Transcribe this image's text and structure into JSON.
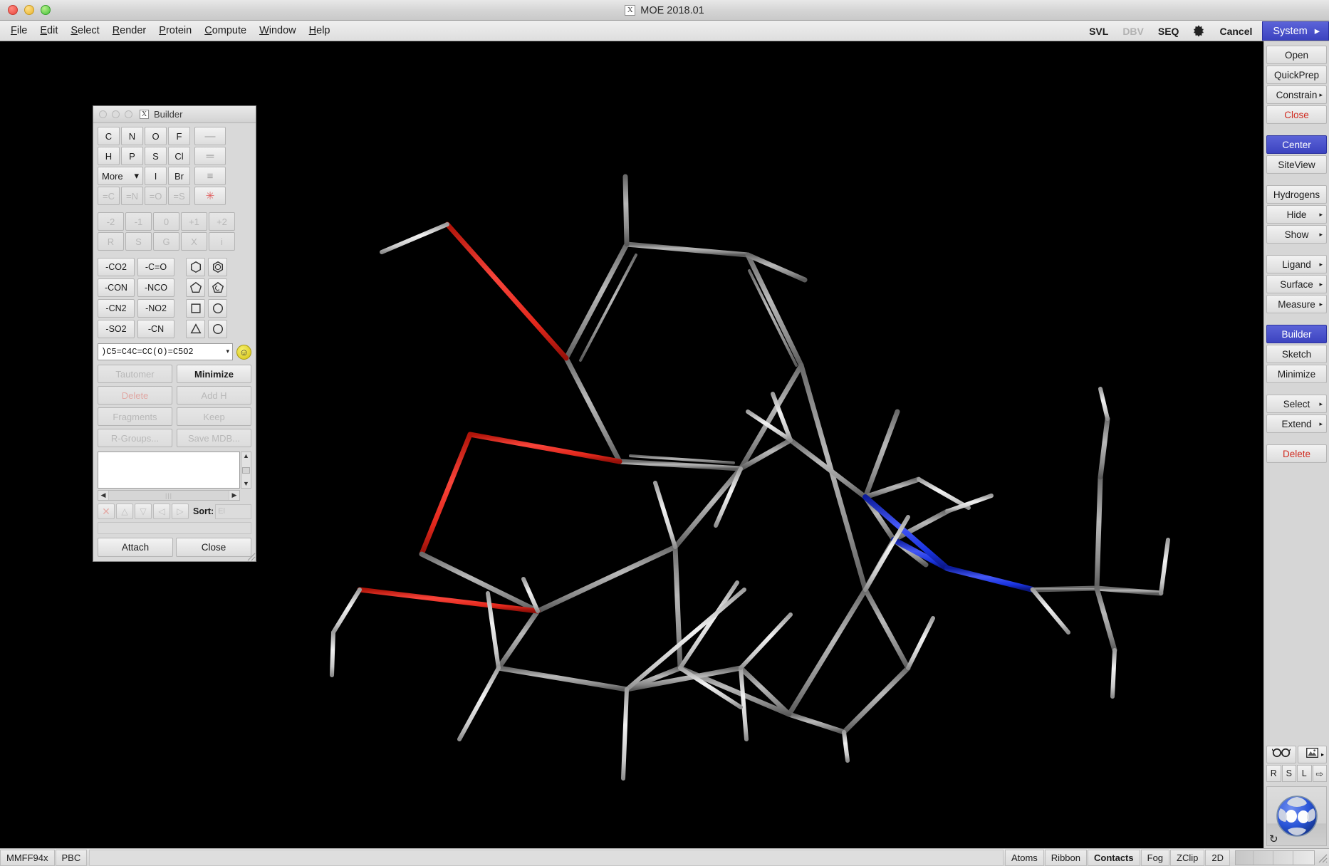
{
  "window": {
    "title": "MOE 2018.01",
    "app_icon": "x-logo-icon"
  },
  "menubar": {
    "items": [
      {
        "label": "File",
        "mnemonic": "F"
      },
      {
        "label": "Edit",
        "mnemonic": "E"
      },
      {
        "label": "Select",
        "mnemonic": "S"
      },
      {
        "label": "Render",
        "mnemonic": "R"
      },
      {
        "label": "Protein",
        "mnemonic": "P"
      },
      {
        "label": "Compute",
        "mnemonic": "C"
      },
      {
        "label": "Window",
        "mnemonic": "W"
      },
      {
        "label": "Help",
        "mnemonic": "H"
      }
    ]
  },
  "toolbar_right": {
    "svl": "SVL",
    "dbv": "DBV",
    "seq": "SEQ",
    "gear": "gear-icon",
    "cancel": "Cancel",
    "system": "System",
    "system_arrow": "▸",
    "accent_blue": "#3c43c0"
  },
  "sidebar": {
    "groups": [
      {
        "items": [
          {
            "label": "Open",
            "arrow": "",
            "state": "normal"
          },
          {
            "label": "QuickPrep",
            "arrow": "",
            "state": "normal"
          },
          {
            "label": "Constrain",
            "arrow": "▸",
            "state": "normal"
          },
          {
            "label": "Close",
            "arrow": "",
            "state": "danger"
          }
        ]
      },
      {
        "items": [
          {
            "label": "Center",
            "arrow": "",
            "state": "selected"
          },
          {
            "label": "SiteView",
            "arrow": "",
            "state": "normal"
          }
        ]
      },
      {
        "items": [
          {
            "label": "Hydrogens",
            "arrow": "",
            "state": "normal"
          },
          {
            "label": "Hide",
            "arrow": "▸",
            "state": "normal"
          },
          {
            "label": "Show",
            "arrow": "▸",
            "state": "normal"
          }
        ]
      },
      {
        "items": [
          {
            "label": "Ligand",
            "arrow": "▸",
            "state": "normal"
          },
          {
            "label": "Surface",
            "arrow": "▸",
            "state": "normal"
          },
          {
            "label": "Measure",
            "arrow": "▸",
            "state": "normal"
          }
        ]
      },
      {
        "items": [
          {
            "label": "Builder",
            "arrow": "",
            "state": "selected"
          },
          {
            "label": "Sketch",
            "arrow": "",
            "state": "normal"
          },
          {
            "label": "Minimize",
            "arrow": "",
            "state": "normal"
          }
        ]
      },
      {
        "items": [
          {
            "label": "Select",
            "arrow": "▸",
            "state": "normal"
          },
          {
            "label": "Extend",
            "arrow": "▸",
            "state": "normal"
          }
        ]
      },
      {
        "items": [
          {
            "label": "Delete",
            "arrow": "",
            "state": "danger"
          }
        ]
      }
    ],
    "bottom_icons": [
      {
        "name": "stereo-glasses-icon"
      },
      {
        "name": "image-snapshot-icon",
        "arrow": "▸"
      }
    ],
    "rsl": [
      {
        "label": "R",
        "name": "rotate-r-button"
      },
      {
        "label": "S",
        "name": "scale-s-button"
      },
      {
        "label": "L",
        "name": "light-l-button"
      },
      {
        "label": "⇨",
        "name": "translate-arrow-button"
      }
    ],
    "globe": "rotation-globe-widget",
    "refresh": "refresh-icon"
  },
  "builder": {
    "title": "Builder",
    "icon": "x-logo-icon",
    "elements_row1": [
      "C",
      "N",
      "O",
      "F"
    ],
    "elements_row2": [
      "H",
      "P",
      "S",
      "Cl"
    ],
    "elements_row3": {
      "more": "More",
      "more_arrow": "▾",
      "i": "I",
      "br": "Br"
    },
    "elements_row4": [
      "=C",
      "=N",
      "=O",
      "=S"
    ],
    "bonds": [
      {
        "label": "—",
        "name": "single-bond-button"
      },
      {
        "label": "═",
        "name": "double-bond-button"
      },
      {
        "label": "≡",
        "name": "triple-bond-button"
      },
      {
        "label": "✳",
        "name": "any-bond-button"
      }
    ],
    "charges": [
      "-2",
      "-1",
      "0",
      "+1",
      "+2"
    ],
    "chirality": [
      "R",
      "S",
      "G",
      "X",
      "i"
    ],
    "functional_groups": [
      [
        "-CO2",
        "-C=O"
      ],
      [
        "-CON",
        "-NCO"
      ],
      [
        "-CN2",
        "-NO2"
      ],
      [
        "-SO2",
        "-CN"
      ]
    ],
    "rings": [
      [
        "benzene-ring-icon",
        "aromatic-ring-icon"
      ],
      [
        "cyclopentane-ring-icon",
        "cyclopentadiene-ring-icon"
      ],
      [
        "cyclobutane-ring-icon",
        "cyclohexane-ring-icon"
      ],
      [
        "cyclopropane-ring-icon",
        "cycloheptane-ring-icon"
      ]
    ],
    "smiles": ")C5=C4C=CC(O)=C5O2",
    "smiles_arrow": "▾",
    "smiley": "☺",
    "actions": [
      {
        "label": "Tautomer",
        "state": "disabled"
      },
      {
        "label": "Minimize",
        "state": "bold"
      },
      {
        "label": "Delete",
        "state": "disabled-red"
      },
      {
        "label": "Add H",
        "state": "disabled"
      },
      {
        "label": "Fragments",
        "state": "disabled"
      },
      {
        "label": "Keep",
        "state": "disabled"
      },
      {
        "label": "R-Groups...",
        "state": "disabled"
      },
      {
        "label": "Save MDB...",
        "state": "disabled"
      }
    ],
    "list_controls": {
      "delete": "✕",
      "up": "△",
      "down": "▽",
      "left": "◁",
      "right": "▷",
      "sort_label": "Sort:",
      "sort_value": "El"
    },
    "footer": {
      "attach": "Attach",
      "close": "Close"
    }
  },
  "statusbar": {
    "left": [
      {
        "label": "MMFF94x",
        "name": "forcefield-button"
      },
      {
        "label": "PBC",
        "name": "pbc-button"
      }
    ],
    "right": [
      {
        "label": "Atoms",
        "bold": false
      },
      {
        "label": "Ribbon",
        "bold": false
      },
      {
        "label": "Contacts",
        "bold": true
      },
      {
        "label": "Fog",
        "bold": false
      },
      {
        "label": "ZClip",
        "bold": false
      },
      {
        "label": "2D",
        "bold": false
      }
    ]
  },
  "viewport": {
    "name": "molecule-3d-viewport",
    "background": "#000000",
    "colors": {
      "carbon": "#8c8c8c",
      "oxygen": "#e2281c",
      "nitrogen": "#1a34e0",
      "hydrogen": "#dcdcdc"
    }
  }
}
